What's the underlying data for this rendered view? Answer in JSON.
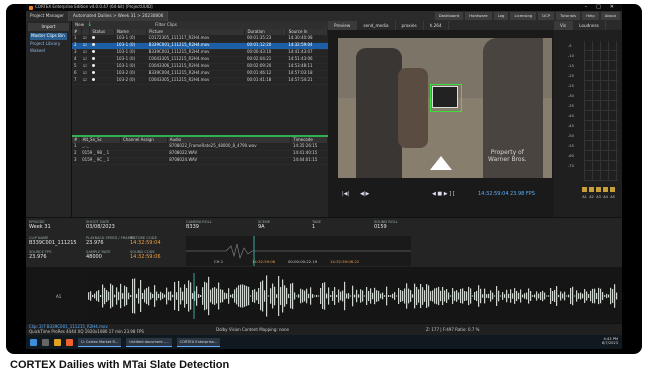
{
  "window": {
    "title": "CORTEX Enterprise Edition v4.0.0.47 (64-bit) [ProjectUUID]"
  },
  "menubar": {
    "tabs": [
      "Project Manager",
      "Automated Dailies > Week 31 > 20230806"
    ],
    "right": [
      "Dashboard",
      "Hardware",
      "Log",
      "Licensing",
      "DCP",
      "Tutorials",
      "Help",
      "About"
    ]
  },
  "leftpanel": {
    "import_label": "Import",
    "items": [
      "Master Clips Bin",
      "Project Library",
      "Wakeel"
    ]
  },
  "clips": {
    "toolbar_new": "New",
    "toolbar_filter": "Filter Clips",
    "columns": [
      "#",
      "",
      "Status",
      "Name",
      "Picture",
      "Duration",
      "Source In"
    ],
    "rows": [
      {
        "n": "1",
        "name": "103-1 (0)",
        "picture": "C0172305_111117_R2H4.mov",
        "duration": "00:01:35:23",
        "src": "14:30:40:08"
      },
      {
        "n": "2",
        "name": "103-1 (0)",
        "picture": "B339C001_111215_R2H4.mov",
        "duration": "00:01:12:20",
        "src": "14:32:59:04"
      },
      {
        "n": "3",
        "name": "103-1 (0)",
        "picture": "B339C003_111215_R2H4.mov",
        "duration": "00:00:43:10",
        "src": "14:41:43:07"
      },
      {
        "n": "4",
        "name": "103-1 (0)",
        "picture": "C0043305_111215_R2H4.mov",
        "duration": "00:02:04:21",
        "src": "14:51:43:06"
      },
      {
        "n": "5",
        "name": "103-1 (0)",
        "picture": "C0043306_111215_R2H4.mov",
        "duration": "00:02:09:20",
        "src": "14:53:48:11"
      },
      {
        "n": "6",
        "name": "103-2 (0)",
        "picture": "B339C004_111215_R2H4.mov",
        "duration": "00:01:46:12",
        "src": "14:57:03:18"
      },
      {
        "n": "7",
        "name": "103-2 (0)",
        "picture": "C0043305_111215_R2H4.mov",
        "duration": "00:01:41:18",
        "src": "14:57:54:21"
      }
    ]
  },
  "audio": {
    "columns": [
      "#",
      "Alt_Sn_Sc",
      "Channel Assign",
      "Audio",
      "Timecode"
    ],
    "rows": [
      {
        "n": "1",
        "alt": "_.._",
        "audio": "8708022_FrameRate25_48000_8_4790.wav",
        "tc": "14:35:26:15"
      },
      {
        "n": "2",
        "alt": "0159 _ 9B _ 1",
        "audio": "8708022.WAV",
        "tc": "14:41:40:15"
      },
      {
        "n": "3",
        "alt": "0159 _ 9C _ 1",
        "audio": "8708024.WAV",
        "tc": "14:44:01:15"
      }
    ]
  },
  "viewer": {
    "tabs": [
      "Preview",
      "send_media",
      "proxies",
      "h.264"
    ],
    "watermark": "Property of\nWarner Bros.",
    "timecode": "14:32:59:04",
    "fps": "23.98 FPS"
  },
  "meters": {
    "tabs": [
      "Vis",
      "Loudness"
    ],
    "ticks": [
      "-5",
      "-10",
      "-15",
      "-20",
      "-25",
      "-30",
      "-35",
      "-40",
      "-45",
      "-50",
      "-55",
      "-60",
      "-70"
    ],
    "channels": [
      "A1",
      "A2",
      "A3",
      "A4",
      "A5"
    ]
  },
  "meta": {
    "episode_l": "EPISODE",
    "episode": "Week 31",
    "shoot_date_l": "SHOOT DATE",
    "shoot_date": "03/08/2023",
    "clip_name_l": "CLIP NAME",
    "clip_name": "B339C001_111215",
    "playback_fps_l": "PLAYBACK SPEED / FRAMES",
    "playback_fps": "23.976",
    "picture_tc_l": "PICTURE CODE",
    "picture_tc": "14:32:59:04",
    "source_fps_l": "SOURCE FPS",
    "source_fps": "23.976",
    "sample_rate_l": "SAMPLE RATE",
    "sample_rate": "48000",
    "sound_code_l": "SOUND CODE",
    "sound_code": "14:32:59:06",
    "camera_roll_l": "CAMERA ROLL",
    "camera_roll": "B339",
    "scene_l": "SCENE",
    "scene": "9A",
    "take_l": "TAKE",
    "take": "1",
    "sound_roll_l": "SOUND ROLL",
    "sound_roll": "0159",
    "ch_label": "CH 1",
    "wf_tc1": "14:32:59:06",
    "wf_tc2": "00:00:00:22.19",
    "wf_tc3": "14:32:59:06.22"
  },
  "waveform": {
    "track_labels": [
      "A1"
    ]
  },
  "statusbar": {
    "left": "Clip: 2/7  B339C001_111215_R2H4.mov",
    "left2": "QuickTime  ProRes 4444 XQ  1920x1080  17 min  23.98 FPS",
    "center": "Dolby Vision Content Mapping: none",
    "tabs": [
      "ALL",
      "COPY",
      "COLOR",
      "SYNC",
      "EDIT",
      "QA",
      "RENDER"
    ],
    "zoom": "Z: 177 | F:497   Ratio: 0.7 %"
  },
  "taskbar": {
    "tasks": [
      "U: Cortex Market R...",
      "Untitled document -...",
      "CORTEX Enterprise..."
    ],
    "time": "4:43 PM",
    "date": "8/7/2023"
  },
  "caption": "CORTEX Dailies with MTai Slate Detection"
}
